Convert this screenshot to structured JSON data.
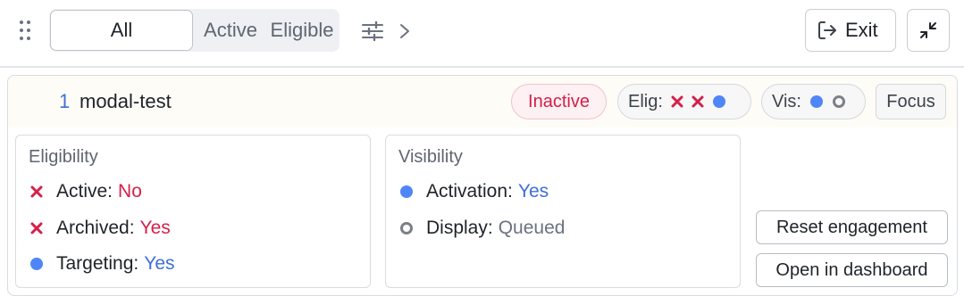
{
  "toolbar": {
    "filters": [
      {
        "label": "All",
        "selected": true
      },
      {
        "label": "Active",
        "selected": false
      },
      {
        "label": "Eligible",
        "selected": false
      }
    ],
    "exit_label": "Exit",
    "icons": {
      "drag": "drag-handle-icon",
      "filter": "sliders-icon",
      "more": "chevron-right-icon",
      "exit": "exit-icon",
      "collapse": "collapse-icon"
    }
  },
  "item": {
    "index": "1",
    "name": "modal-test",
    "status_label": "Inactive",
    "elig_label": "Elig:",
    "vis_label": "Vis:",
    "focus_label": "Focus",
    "eligibility": {
      "title": "Eligibility",
      "rows": [
        {
          "label": "Active:",
          "value": "No",
          "state": "fail"
        },
        {
          "label": "Archived:",
          "value": "Yes",
          "state": "fail"
        },
        {
          "label": "Targeting:",
          "value": "Yes",
          "state": "ok"
        }
      ]
    },
    "visibility": {
      "title": "Visibility",
      "rows": [
        {
          "label": "Activation:",
          "value": "Yes",
          "state": "ok"
        },
        {
          "label": "Display:",
          "value": "Queued",
          "state": "pending"
        }
      ]
    },
    "actions": {
      "reset_label": "Reset engagement",
      "open_label": "Open in dashboard"
    }
  },
  "colors": {
    "fail": "#d4204a",
    "ok": "#3f6fd8",
    "ok_dot": "#4f86f7",
    "pending": "#7b8088"
  }
}
